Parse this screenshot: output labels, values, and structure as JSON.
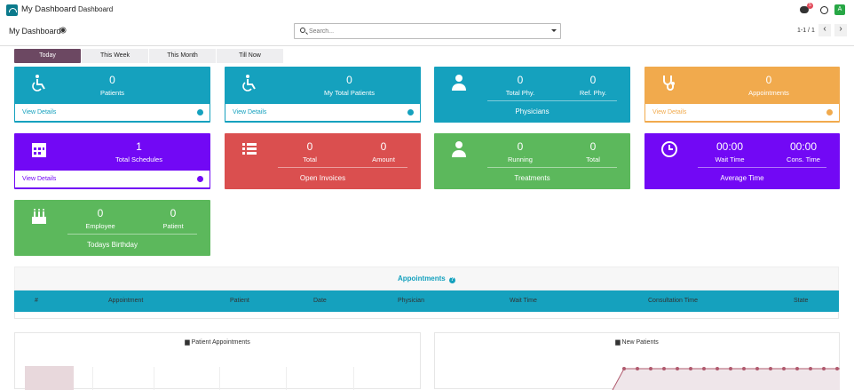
{
  "topbar": {
    "title": "My Dashboard",
    "menu": "Dashboard",
    "badge": "5",
    "avatar": "A"
  },
  "control": {
    "breadcrumb": "My Dashboard",
    "search_placeholder": "Search...",
    "pager": "1-1 / 1",
    "prev": "‹",
    "next": "›"
  },
  "tabs": [
    "Today",
    "This Week",
    "This Month",
    "Till Now"
  ],
  "cards": {
    "patients": {
      "value": "0",
      "label": "Patients",
      "foot": "View Details"
    },
    "my_patients": {
      "value": "0",
      "label": "My Total Patients",
      "foot": "View Details"
    },
    "physicians": {
      "total_val": "0",
      "total_lbl": "Total Phy.",
      "ref_val": "0",
      "ref_lbl": "Ref. Phy.",
      "title": "Physicians"
    },
    "appointments": {
      "value": "0",
      "label": "Appointments",
      "foot": "View Details"
    },
    "schedules": {
      "value": "1",
      "label": "Total Schedules",
      "foot": "View Details"
    },
    "invoices": {
      "total_val": "0",
      "total_lbl": "Total",
      "amount_val": "0",
      "amount_lbl": "Amount",
      "title": "Open Invoices"
    },
    "treatments": {
      "running_val": "0",
      "running_lbl": "Running",
      "total_val": "0",
      "total_lbl": "Total",
      "title": "Treatments"
    },
    "average_time": {
      "wait_val": "00:00",
      "wait_lbl": "Wait Time",
      "cons_val": "00:00",
      "cons_lbl": "Cons. Time",
      "title": "Average Time"
    },
    "birthday": {
      "emp_val": "0",
      "emp_lbl": "Employee",
      "pat_val": "0",
      "pat_lbl": "Patient",
      "title": "Todays Birthday"
    }
  },
  "appointments_section": {
    "title": "Appointments",
    "columns": [
      "#",
      "Appointment",
      "Patient",
      "Date",
      "Physician",
      "Wait Time",
      "Consultation Time",
      "State"
    ]
  },
  "charts": {
    "patient_appointments": "Patient Appointments",
    "new_patients": "New Patients"
  },
  "colors": {
    "teal": "#15a1be",
    "violet": "#7208f5",
    "orange": "#f1aa4d",
    "red": "#da4f4f",
    "green": "#5cb85c",
    "tab_active": "#6c4862"
  }
}
